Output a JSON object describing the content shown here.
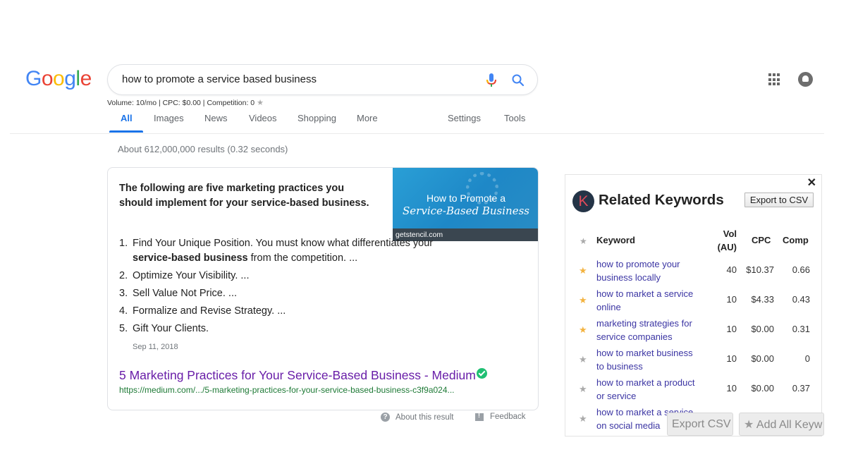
{
  "logo": {
    "letters": [
      "G",
      "o",
      "o",
      "g",
      "l",
      "e"
    ],
    "colors": [
      "#4285f4",
      "#ea4335",
      "#fbbc05",
      "#4285f4",
      "#34a853",
      "#ea4335"
    ]
  },
  "search": {
    "query": "how to promote a service based business"
  },
  "keyword_stats": {
    "text": "Volume: 10/mo | CPC: $0.00 | Competition: 0",
    "icon": "star-icon"
  },
  "tabs": [
    {
      "label": "All",
      "active": true
    },
    {
      "label": "Images"
    },
    {
      "label": "News"
    },
    {
      "label": "Videos"
    },
    {
      "label": "Shopping"
    },
    {
      "label": "More"
    },
    {
      "label": "Settings"
    },
    {
      "label": "Tools"
    }
  ],
  "result_stats": "About 612,000,000 results (0.32 seconds)",
  "snippet": {
    "heading": "The following are five marketing practices you should implement for your service-based business.",
    "image": {
      "line1": "How to Promote a",
      "line2": "Service-Based Business",
      "source": "getstencil.com"
    },
    "list": [
      {
        "num": "1.",
        "pre": "Find Your Unique Position. You must know what differentiates your ",
        "bold": "service-based business",
        "post": " from the competition. ..."
      },
      {
        "num": "2.",
        "pre": "Optimize Your Visibility. ...",
        "bold": "",
        "post": ""
      },
      {
        "num": "3.",
        "pre": "Sell Value Not Price. ...",
        "bold": "",
        "post": ""
      },
      {
        "num": "4.",
        "pre": "Formalize and Revise Strategy. ...",
        "bold": "",
        "post": ""
      },
      {
        "num": "5.",
        "pre": "Gift Your Clients.",
        "bold": "",
        "post": ""
      }
    ],
    "date": "Sep 11, 2018",
    "title": "5 Marketing Practices for Your Service-Based Business - Medium",
    "url": "https://medium.com/.../5-marketing-practices-for-your-service-based-business-c3f9a024..."
  },
  "footer_links": {
    "about": "About this result",
    "feedback": "Feedback"
  },
  "keywords_panel": {
    "logo_letter": "K",
    "title": "Related Keywords",
    "export_top": "Export to CSV",
    "columns": {
      "keyword": "Keyword",
      "vol": "Vol (AU)",
      "cpc": "CPC",
      "comp": "Comp"
    },
    "rows": [
      {
        "keyword": "how to promote your business locally",
        "vol": "40",
        "cpc": "$10.37",
        "comp": "0.66",
        "starred": true
      },
      {
        "keyword": "how to market a service online",
        "vol": "10",
        "cpc": "$4.33",
        "comp": "0.43",
        "starred": true
      },
      {
        "keyword": "marketing strategies for service companies",
        "vol": "10",
        "cpc": "$0.00",
        "comp": "0.31",
        "starred": true
      },
      {
        "keyword": "how to market business to business",
        "vol": "10",
        "cpc": "$0.00",
        "comp": "0",
        "starred": false
      },
      {
        "keyword": "how to market a product or service",
        "vol": "10",
        "cpc": "$0.00",
        "comp": "0.37",
        "starred": false
      },
      {
        "keyword": "how to market a service on social media",
        "vol": "",
        "cpc": "",
        "comp": "",
        "starred": false
      }
    ],
    "export_bottom": "Export CSV",
    "add_all": "Add All Keyw"
  }
}
